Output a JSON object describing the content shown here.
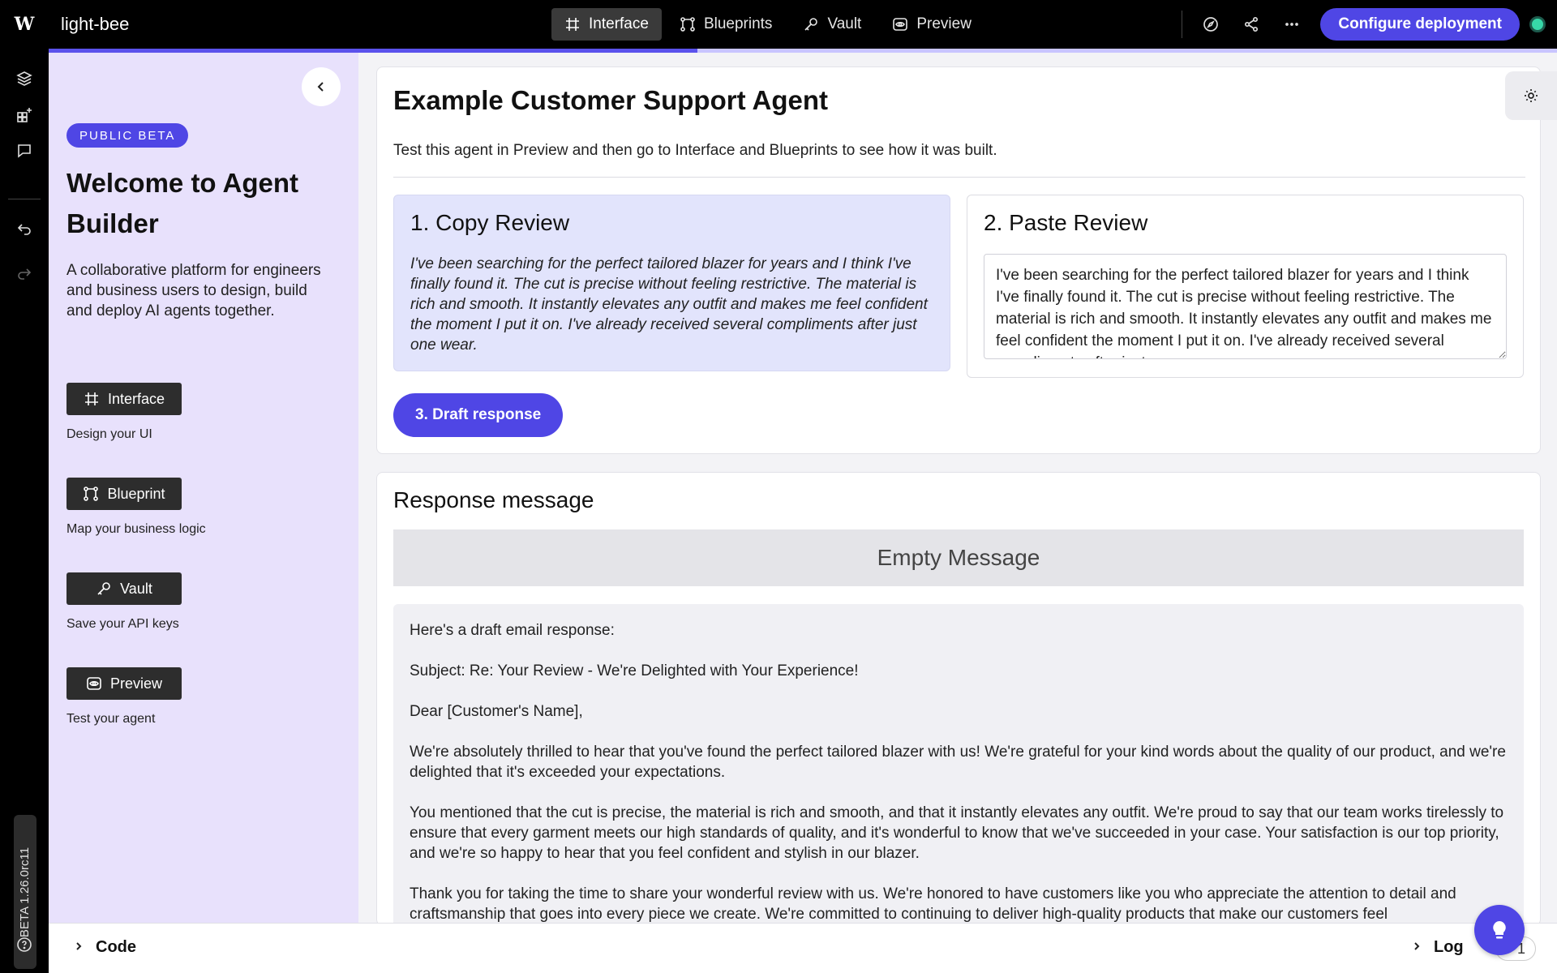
{
  "app": {
    "logo": "W",
    "name": "light-bee"
  },
  "nav": {
    "tabs": [
      {
        "label": "Interface",
        "icon": "grid-hash-icon"
      },
      {
        "label": "Blueprints",
        "icon": "blueprint-nodes-icon"
      },
      {
        "label": "Vault",
        "icon": "key-icon"
      },
      {
        "label": "Preview",
        "icon": "eye-icon"
      }
    ],
    "active_tab": "Interface"
  },
  "topbar": {
    "deploy_label": "Configure deployment",
    "status_color": "#37d8a8"
  },
  "progress": {
    "fraction": 0.43
  },
  "rail": {
    "version": "BETA 1.26.0rc11"
  },
  "side": {
    "badge": "PUBLIC BETA",
    "title": "Welcome to Agent Builder",
    "intro": "A collaborative platform for engineers and business users to design, build and deploy AI agents together.",
    "tools": [
      {
        "label": "Interface",
        "caption": "Design your UI"
      },
      {
        "label": "Blueprint",
        "caption": "Map your business logic"
      },
      {
        "label": "Vault",
        "caption": "Save your API keys"
      },
      {
        "label": "Preview",
        "caption": "Test your agent"
      }
    ]
  },
  "main": {
    "title": "Example Customer Support Agent",
    "subtitle": "Test this agent in Preview and then go to Interface and Blueprints to see how it was built.",
    "copy": {
      "title": "1. Copy Review",
      "text": "I've been searching for the perfect tailored blazer for years and I think I've finally found it. The cut is precise without feeling restrictive. The material is rich and smooth. It instantly elevates any outfit and makes me feel confident the moment I put it on. I've already received several compliments after just one wear."
    },
    "paste": {
      "title": "2. Paste Review",
      "value": "I've been searching for the perfect tailored blazer for years and I think I've finally found it. The cut is precise without feeling restrictive. The material is rich and smooth. It instantly elevates any outfit and makes me feel confident the moment I put it on. I've already received several compliments after just one wear."
    },
    "draft_label": "3. Draft response"
  },
  "response": {
    "title": "Response message",
    "empty": "Empty Message",
    "paragraphs": [
      "Here's a draft email response:",
      "Subject: Re: Your Review - We're Delighted with Your Experience!",
      "Dear [Customer's Name],",
      "We're absolutely thrilled to hear that you've found the perfect tailored blazer with us! We're grateful for your kind words about the quality of our product, and we're delighted that it's exceeded your expectations.",
      "You mentioned that the cut is precise, the material is rich and smooth, and that it instantly elevates any outfit. We're proud to say that our team works tirelessly to ensure that every garment meets our high standards of quality, and it's wonderful to know that we've succeeded in your case. Your satisfaction is our top priority, and we're so happy to hear that you feel confident and stylish in our blazer.",
      "Thank you for taking the time to share your wonderful review with us. We're honored to have customers like you who appreciate the attention to detail and craftsmanship that goes into every piece we create. We're committed to continuing to deliver high-quality products that make our customers feel"
    ]
  },
  "bottom": {
    "code_label": "Code",
    "log_label": "Log",
    "log_count": "1"
  },
  "colors": {
    "accent": "#4f46e5",
    "side_bg": "#e8e1fc",
    "copy_bg": "#e2e4fc"
  }
}
